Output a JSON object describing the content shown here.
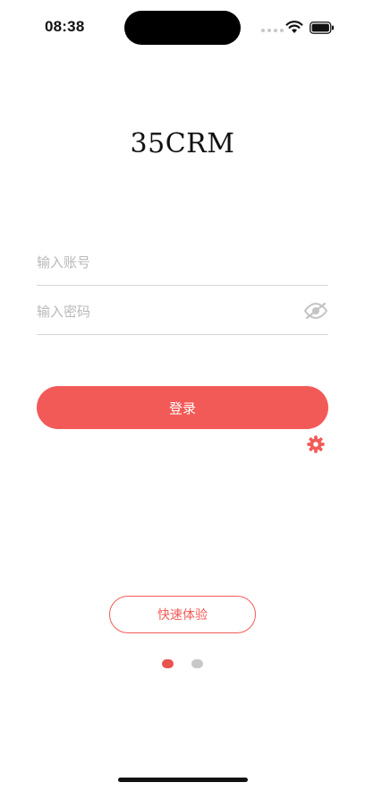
{
  "status_bar": {
    "time": "08:38"
  },
  "app": {
    "logo_text": "35CRM"
  },
  "login_form": {
    "account_placeholder": "输入账号",
    "account_value": "",
    "password_placeholder": "输入密码",
    "password_value": "",
    "login_label": "登录"
  },
  "quick": {
    "label": "快速体验"
  },
  "pager": {
    "count": 2,
    "active_index": 0
  },
  "icons": {
    "password_toggle": "eye-slash-icon",
    "settings": "gear-icon",
    "wifi": "wifi-icon",
    "battery": "battery-icon"
  },
  "colors": {
    "accent": "#f25a57",
    "inactive_dot": "#c8c8c8"
  }
}
